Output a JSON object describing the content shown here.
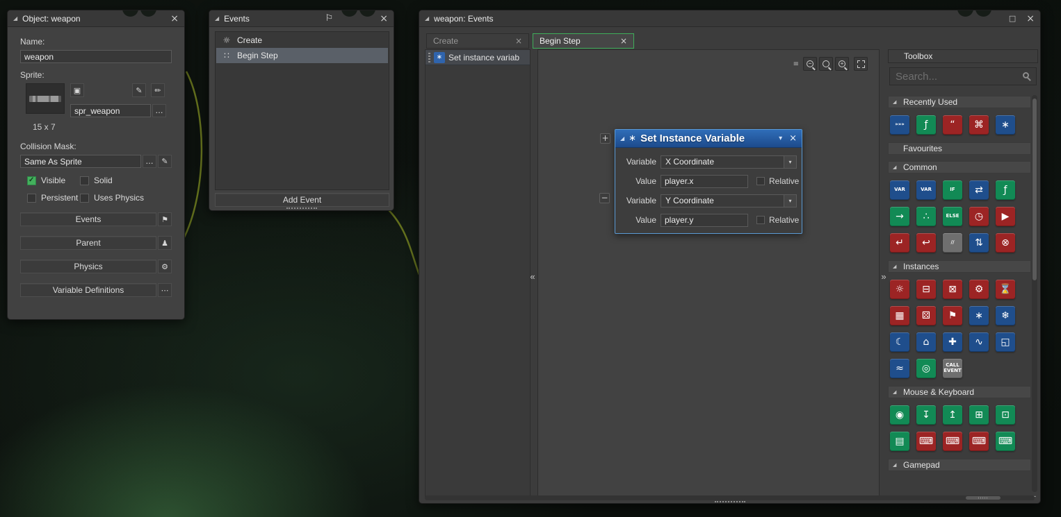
{
  "icons": {
    "close": "×",
    "collapse": "◢",
    "chevron_down": "▾",
    "maximize": "□",
    "collapse_left": "«",
    "collapse_right": "»",
    "menu": "≡",
    "add": "+",
    "remove": "−",
    "node": "∗",
    "flag_outline": "⚐"
  },
  "colors": {
    "accent_green": "#3fae5a",
    "node_header_blue": "#2f6db8",
    "checkbox_green": "#43b05c",
    "link_curve": "#6d7a1f"
  },
  "object_window": {
    "title": "Object: weapon",
    "name_label": "Name:",
    "name_value": "weapon",
    "sprite_label": "Sprite:",
    "sprite_name": "spr_weapon",
    "sprite_size": "15 x 7",
    "collision_label": "Collision Mask:",
    "collision_value": "Same As Sprite",
    "more_glyph": "…",
    "sprite_buttons": {
      "new": "▣",
      "edit": "✎",
      "paint": "✏"
    },
    "checkboxes": [
      {
        "label": "Visible",
        "checked": true
      },
      {
        "label": "Solid",
        "checked": false
      },
      {
        "label": "Persistent",
        "checked": false
      },
      {
        "label": "Uses Physics",
        "checked": false
      }
    ],
    "action_buttons": [
      {
        "label": "Events",
        "icon": "flag-icon",
        "glyph": "⚑"
      },
      {
        "label": "Parent",
        "icon": "parent-icon",
        "glyph": "♟"
      },
      {
        "label": "Physics",
        "icon": "gear-icon",
        "glyph": "⚙"
      },
      {
        "label": "Variable Definitions",
        "icon": "ellipsis-icon",
        "glyph": "⋯"
      }
    ]
  },
  "events_window": {
    "title": "Events",
    "items": [
      {
        "label": "Create",
        "selected": false,
        "glyph": "☼"
      },
      {
        "label": "Begin Step",
        "selected": true,
        "glyph": "∷"
      }
    ],
    "add_button": "Add Event"
  },
  "editor": {
    "title": "weapon: Events",
    "tabs": [
      {
        "label": "Create",
        "active": false
      },
      {
        "label": "Begin Step",
        "active": true
      }
    ],
    "sidebar_item": "Set instance variab",
    "node": {
      "title": "Set Instance Variable",
      "variable_rows": [
        {
          "label": "Variable",
          "value": "X Coordinate"
        },
        {
          "label": "Value",
          "value": "player.x",
          "relative": "Relative",
          "relative_checked": false
        },
        {
          "label": "Variable",
          "value": "Y Coordinate"
        },
        {
          "label": "Value",
          "value": "player.y",
          "relative": "Relative",
          "relative_checked": false
        }
      ]
    }
  },
  "toolbox": {
    "title": "Toolbox",
    "search_placeholder": "Search...",
    "colors": {
      "blue": "#1f4e8c",
      "green": "#128a55",
      "red": "#9c2424",
      "gray": "#6f6f6f"
    },
    "sections": [
      {
        "label": "Recently Used",
        "collapsible": true,
        "icons": [
          {
            "name": "repeat-icon",
            "color": "blue",
            "glyph": "»»»",
            "small": true
          },
          {
            "name": "function-call-icon",
            "color": "green",
            "glyph": "ƒ"
          },
          {
            "name": "show-message-icon",
            "color": "red",
            "glyph": "“"
          },
          {
            "name": "execute-script-icon",
            "color": "red",
            "glyph": "⌘"
          },
          {
            "name": "set-instance-variable-icon",
            "color": "blue",
            "glyph": "∗"
          }
        ]
      },
      {
        "label": "Favourites",
        "collapsible": false,
        "icons": []
      },
      {
        "label": "Common",
        "collapsible": true,
        "icons": [
          {
            "name": "assign-variable-icon",
            "color": "blue",
            "glyph": "VAR",
            "small": true
          },
          {
            "name": "global-variable-icon",
            "color": "blue",
            "glyph": "VAR",
            "small": true
          },
          {
            "name": "if-variable-icon",
            "color": "green",
            "glyph": "IF",
            "small": true
          },
          {
            "name": "evaluate-expression-icon",
            "color": "blue",
            "glyph": "⇄"
          },
          {
            "name": "function-call-icon",
            "color": "green",
            "glyph": "ƒ"
          },
          {
            "name": "apply-to-icon",
            "color": "green",
            "glyph": "→"
          },
          {
            "name": "with-icon",
            "color": "green",
            "glyph": "∴"
          },
          {
            "name": "else-icon",
            "color": "green",
            "glyph": "ELSE",
            "small": true
          },
          {
            "name": "alarm-icon",
            "color": "red",
            "glyph": "◷"
          },
          {
            "name": "resume-icon",
            "color": "red",
            "glyph": "▶"
          },
          {
            "name": "return-icon",
            "color": "red",
            "glyph": "↵"
          },
          {
            "name": "exit-event-icon",
            "color": "red",
            "glyph": "↩"
          },
          {
            "name": "comment-icon",
            "color": "gray",
            "glyph": "//",
            "small": true
          },
          {
            "name": "switch-icon",
            "color": "blue",
            "glyph": "⇅"
          },
          {
            "name": "break-icon",
            "color": "red",
            "glyph": "⊗"
          }
        ]
      },
      {
        "label": "Instances",
        "collapsible": true,
        "icons": [
          {
            "name": "create-instance-icon",
            "color": "red",
            "glyph": "☼"
          },
          {
            "name": "destroy-instance-icon",
            "color": "red",
            "glyph": "⊟"
          },
          {
            "name": "destroy-at-position-icon",
            "color": "red",
            "glyph": "⊠"
          },
          {
            "name": "instance-change-icon",
            "color": "red",
            "glyph": "⚙"
          },
          {
            "name": "instance-timer-icon",
            "color": "red",
            "glyph": "⌛"
          },
          {
            "name": "deactivate-instance-icon",
            "color": "red",
            "glyph": "▦"
          },
          {
            "name": "activate-instance-icon",
            "color": "red",
            "glyph": "⚄"
          },
          {
            "name": "room-flag-icon",
            "color": "red",
            "glyph": "⚑"
          },
          {
            "name": "set-instance-variable-icon",
            "color": "blue",
            "glyph": "∗"
          },
          {
            "name": "snowflake-icon",
            "color": "blue",
            "glyph": "❄"
          },
          {
            "name": "moon-icon",
            "color": "blue",
            "glyph": "☾"
          },
          {
            "name": "ghost-icon",
            "color": "blue",
            "glyph": "⌂"
          },
          {
            "name": "add-instance-variable-icon",
            "color": "blue",
            "glyph": "✚"
          },
          {
            "name": "path-icon",
            "color": "blue",
            "glyph": "∿"
          },
          {
            "name": "layer-icon",
            "color": "blue",
            "glyph": "◱"
          },
          {
            "name": "wave-icon",
            "color": "blue",
            "glyph": "≈"
          },
          {
            "name": "target-icon",
            "color": "green",
            "glyph": "◎"
          },
          {
            "name": "call-event-icon",
            "color": "gray",
            "glyph": "CALL EVENT",
            "small": true
          }
        ]
      },
      {
        "label": "Mouse & Keyboard",
        "collapsible": true,
        "icons": [
          {
            "name": "mouse-cursor-icon",
            "color": "green",
            "glyph": "◉"
          },
          {
            "name": "mouse-down-icon",
            "color": "green",
            "glyph": "↧"
          },
          {
            "name": "mouse-up-icon",
            "color": "green",
            "glyph": "↥"
          },
          {
            "name": "mouse-button-grid-icon",
            "color": "green",
            "glyph": "⊞"
          },
          {
            "name": "mouse-wheel-icon",
            "color": "green",
            "glyph": "⊡"
          },
          {
            "name": "keyboard-layout-icon",
            "color": "green",
            "glyph": "▤"
          },
          {
            "name": "keyboard-check-icon",
            "color": "red",
            "glyph": "⌨"
          },
          {
            "name": "keyboard-pressed-icon",
            "color": "red",
            "glyph": "⌨"
          },
          {
            "name": "keyboard-released-icon",
            "color": "red",
            "glyph": "⌨"
          },
          {
            "name": "keyboard-clear-icon",
            "color": "green",
            "glyph": "⌨"
          }
        ]
      },
      {
        "label": "Gamepad",
        "collapsible": true,
        "icons": []
      }
    ]
  }
}
